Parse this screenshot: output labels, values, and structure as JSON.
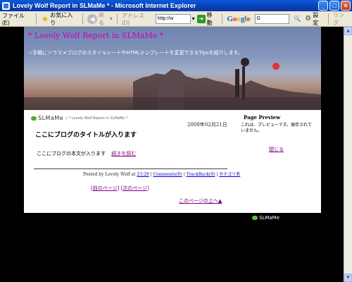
{
  "window": {
    "title": "Lovely Wolf Report in SLMaMe * - Microsoft Internet Explorer"
  },
  "toolbar": {
    "file": "ファイル(E)",
    "favorites": "お気に入り",
    "back": "戻る",
    "address_label": "アドレス(D)",
    "address_value": "http://w",
    "go": "移動",
    "google_search_value": "G",
    "settings": "設定",
    "links": "リンク"
  },
  "blog": {
    "title": "* Lovely Wolf Report in SLMaMe *",
    "subtitle": "☆手軽にソラマメブログのスタイルシートやHTMLテンプレートを変更できるTipsを紹介します。",
    "logo_text": "SLMaMe",
    "breadcrumb": "» * Lovely Wolf Report in SLMaMe *",
    "date": "2008年02月21日",
    "post_title": "ここにブログのタイトルが入ります",
    "post_body": "ここにブログの本文が入ります",
    "read_more": "続きを読む",
    "foot_posted_by": "Posted by Lovely Wolf at",
    "foot_time": "23:29",
    "foot_comments": "Comments(0)",
    "foot_trackback": "TrackBack(0)",
    "foot_category": "カテゴリ名",
    "pager_prev": "前のページ",
    "pager_next": "次のページ",
    "page_top": "このページの上へ▲",
    "preview_title": "Page Preview",
    "preview_text": "これは、プレビューです。保存されていません。",
    "preview_close": "閉じる",
    "footer_logo": "SLMaMe"
  }
}
